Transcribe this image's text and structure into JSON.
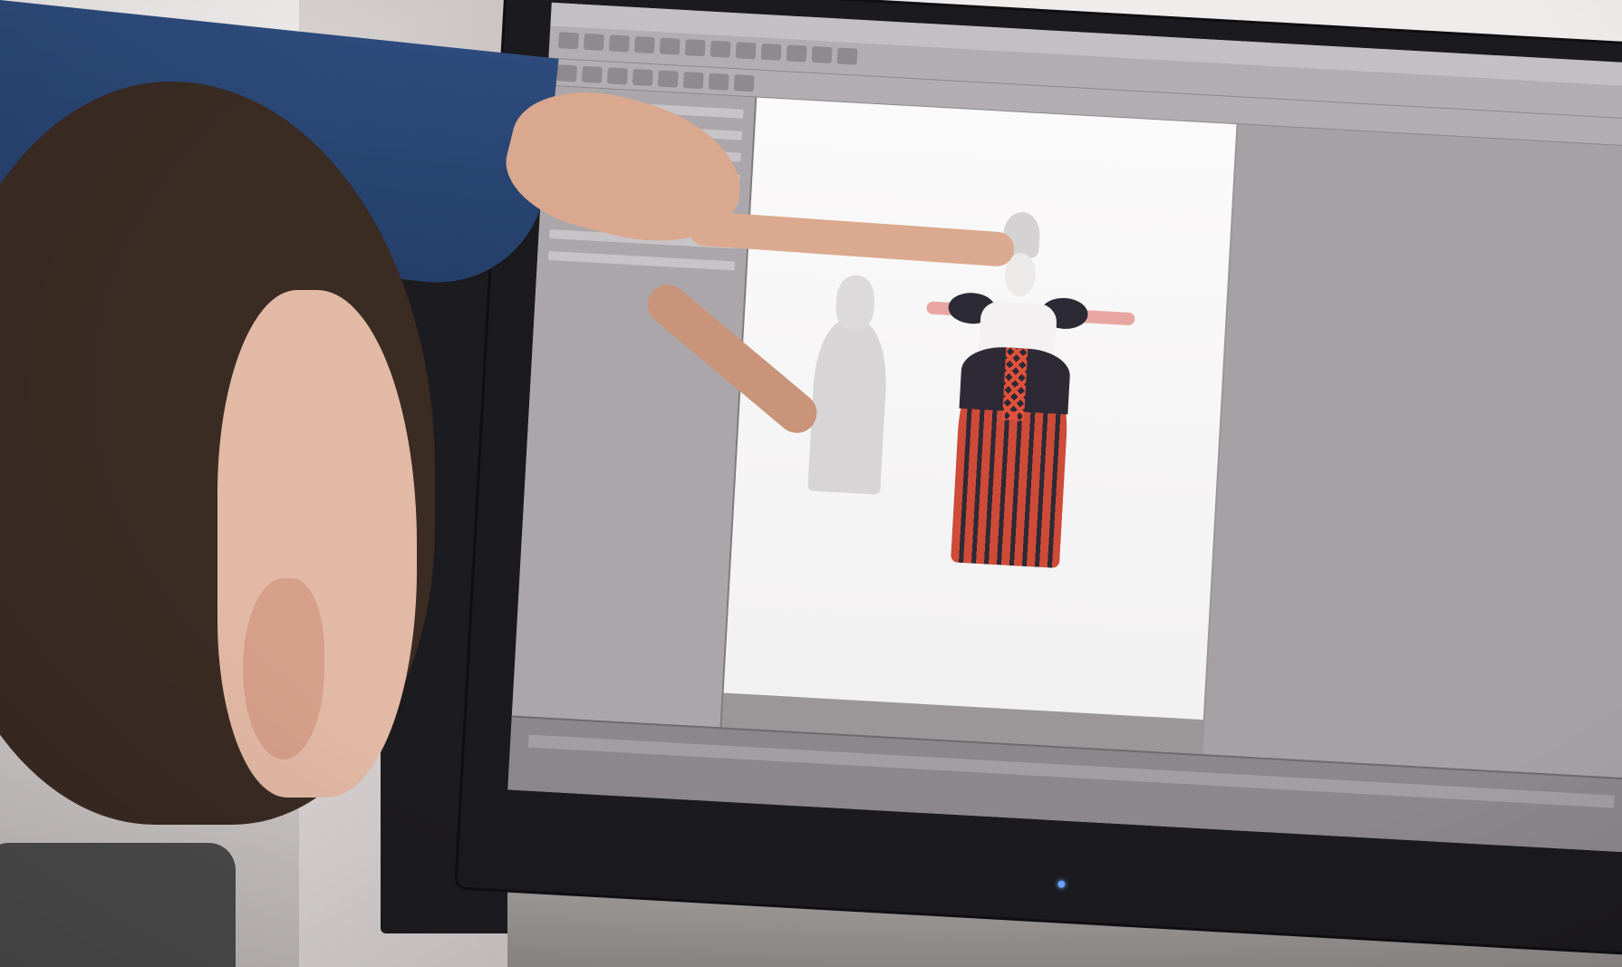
{
  "scene": {
    "subject": "",
    "colors": {
      "sleeve": "#2d4b7c",
      "skin": "#dba98f",
      "hair": "#3a2b23",
      "monitor": "#1b1a1e",
      "ui_gray": "#9b9799",
      "viewport": "#fbfafa",
      "dress_red": "#cf4b37",
      "dress_dark": "#2d2a36"
    }
  }
}
